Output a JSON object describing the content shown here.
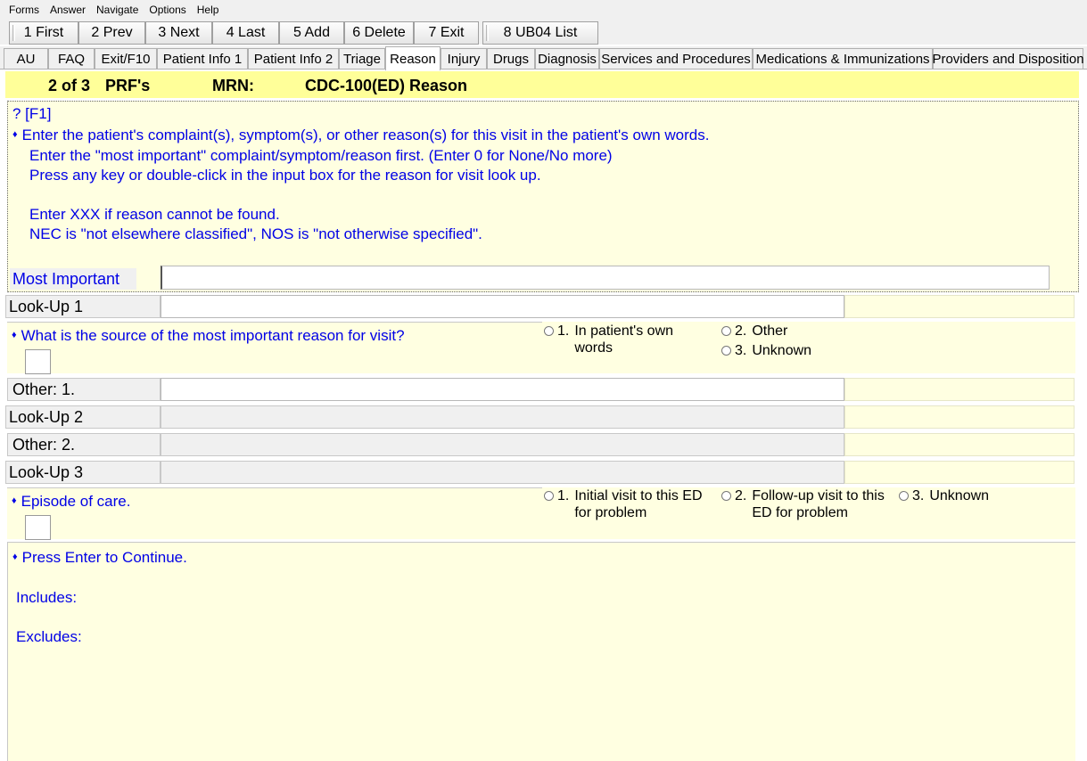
{
  "menu": [
    "Forms",
    "Answer",
    "Navigate",
    "Options",
    "Help"
  ],
  "toolbar": {
    "first": "1 First",
    "prev": "2 Prev",
    "next": "3 Next",
    "last": "4 Last",
    "add": "5 Add",
    "delete": "6 Delete",
    "exit": "7 Exit",
    "ub04": "8 UB04 List"
  },
  "tabs": [
    "AU",
    "FAQ",
    "Exit/F10",
    "Patient Info 1",
    "Patient Info 2",
    "Triage",
    "Reason",
    "Injury",
    "Drugs",
    "Diagnosis",
    "Services and Procedures",
    "Medications & Immunizations",
    "Providers and Disposition"
  ],
  "active_tab": "Reason",
  "header": {
    "record": "2 of 3",
    "prf": "PRF's",
    "mrn_label": "MRN:",
    "form": "CDC-100(ED) Reason"
  },
  "instructions": {
    "help": "? [F1]",
    "line1": "Enter the patient's complaint(s), symptom(s), or other reason(s) for this visit in the patient's own words.",
    "line2": "Enter the \"most important\" complaint/symptom/reason first. (Enter 0 for None/No more)",
    "line3": "Press any key or double-click in the input box for the reason for visit look up.",
    "line4": "Enter XXX if reason cannot be found.",
    "line5": "NEC is \"not elsewhere classified\", NOS is \"not otherwise specified\"."
  },
  "most_important": {
    "label": "Most Important",
    "value": ""
  },
  "lookup1": {
    "label": "Look-Up 1",
    "value": ""
  },
  "source": {
    "question": "What is the source of the most important reason for visit?",
    "options": [
      {
        "num": "1.",
        "text": "In patient's own words"
      },
      {
        "num": "2.",
        "text": "Other"
      },
      {
        "num": "3.",
        "text": "Unknown"
      }
    ]
  },
  "other1": {
    "label": "Other: 1.",
    "value": ""
  },
  "lookup2": {
    "label": "Look-Up 2"
  },
  "other2": {
    "label": "Other: 2."
  },
  "lookup3": {
    "label": "Look-Up 3"
  },
  "episode": {
    "question": "Episode of care.",
    "options": [
      {
        "num": "1.",
        "text": "Initial visit to this ED for problem"
      },
      {
        "num": "2.",
        "text": "Follow-up visit to this ED for problem"
      },
      {
        "num": "3.",
        "text": "Unknown"
      }
    ]
  },
  "bottom": {
    "continue": "Press Enter to Continue.",
    "includes": "Includes:",
    "excludes": "Excludes:"
  }
}
